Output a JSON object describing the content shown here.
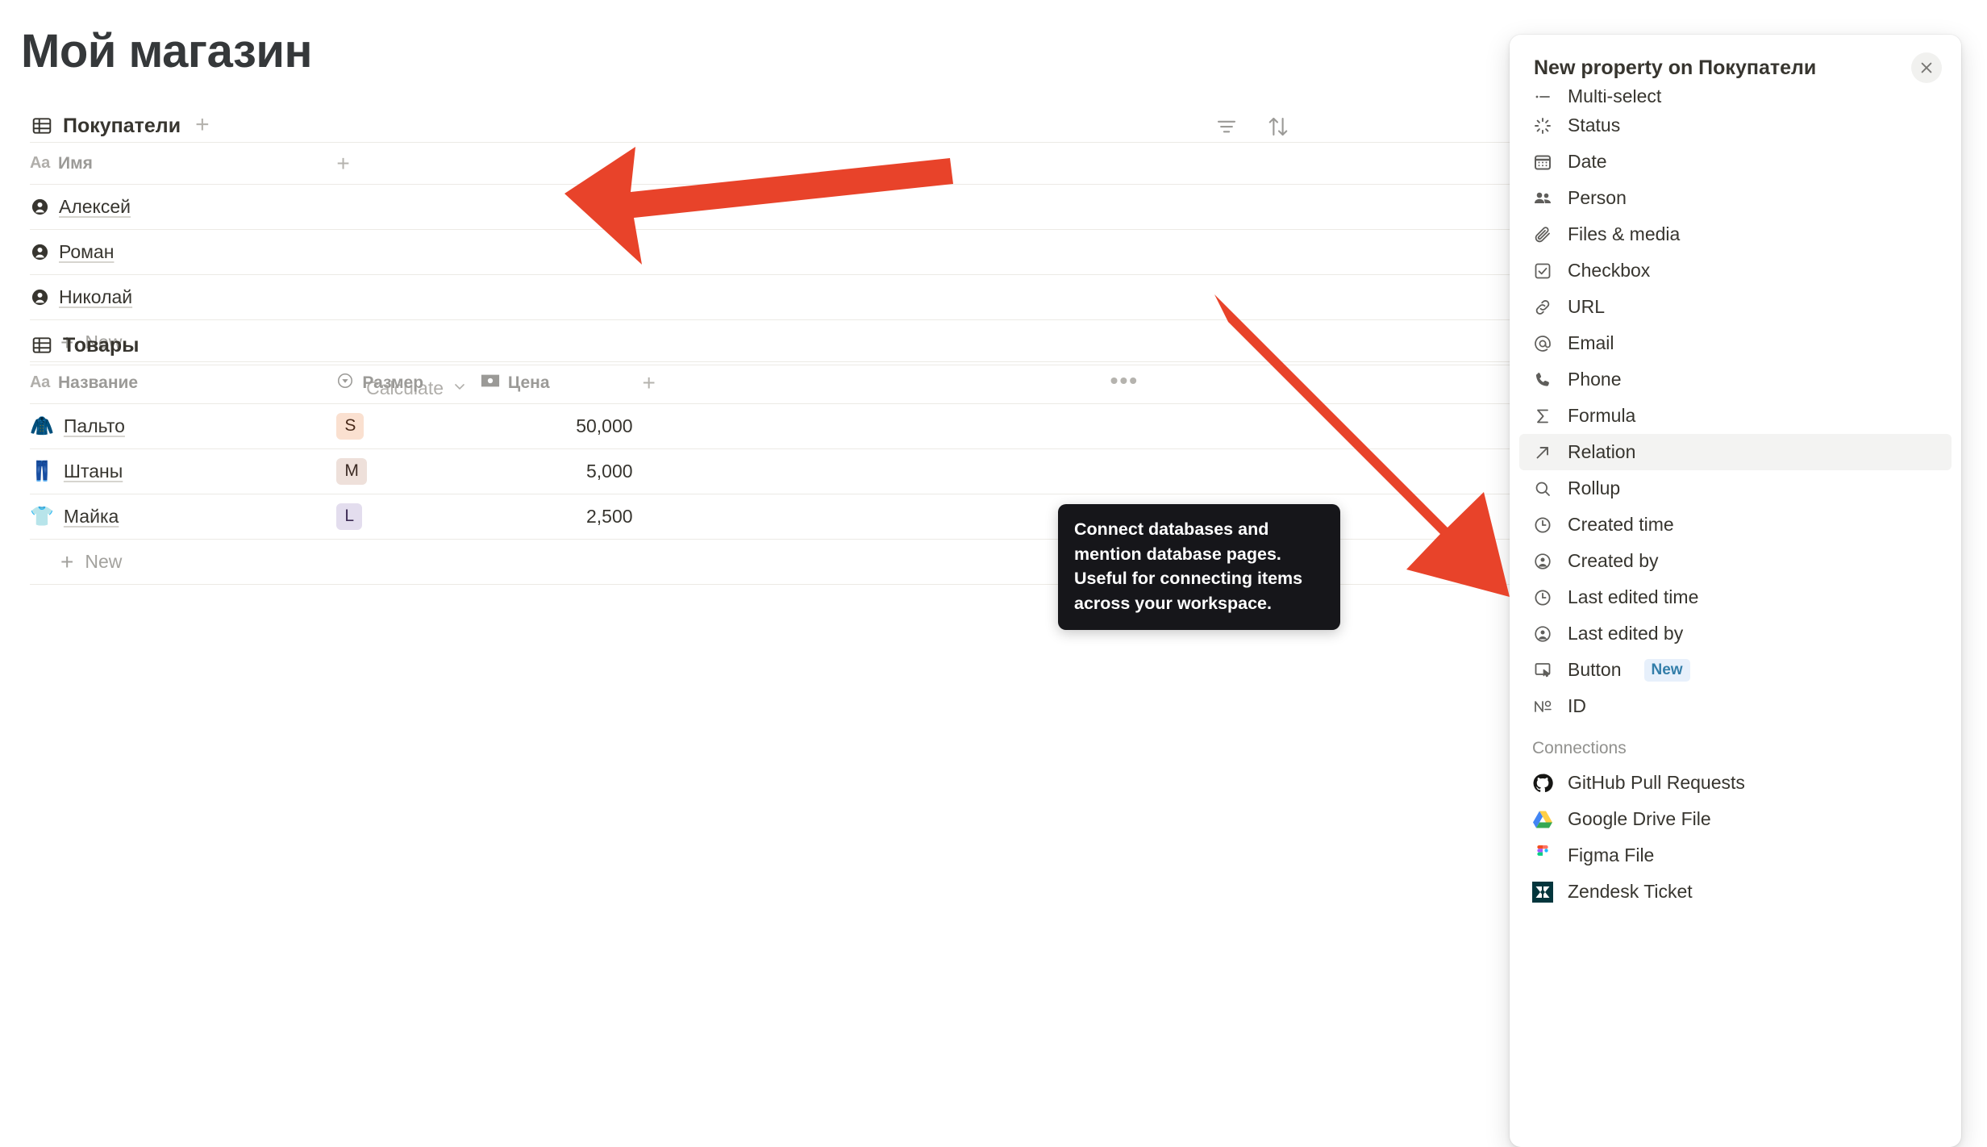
{
  "page": {
    "title": "Мой магазин"
  },
  "databases": [
    {
      "name": "Покупатели",
      "add_label": "+",
      "toolbar": {
        "filter_icon": "filter-icon",
        "sort_icon": "sort-icon"
      },
      "columns": [
        {
          "label": "Имя",
          "type_icon": "aa-text-icon",
          "prefix": "Aa"
        }
      ],
      "add_column_label": "+",
      "rows": [
        {
          "icon": "person-icon",
          "name": "Алексей"
        },
        {
          "icon": "person-icon",
          "name": "Роман"
        },
        {
          "icon": "person-icon",
          "name": "Николай"
        }
      ],
      "new_row_label": "New",
      "calculate_label": "Calculate"
    },
    {
      "name": "Товары",
      "columns": [
        {
          "label": "Название",
          "type_icon": "aa-text-icon",
          "prefix": "Aa"
        },
        {
          "label": "Размер",
          "type_icon": "select-icon"
        },
        {
          "label": "Цена",
          "type_icon": "money-icon"
        }
      ],
      "add_column_label": "+",
      "more_label": "•••",
      "rows": [
        {
          "emoji": "🧥",
          "name": "Пальто",
          "size": "S",
          "size_bg": "#fae0d0",
          "size_fg": "#4a2b1b",
          "price": "50,000"
        },
        {
          "emoji": "👖",
          "name": "Штаны",
          "size": "M",
          "size_bg": "#eee0da",
          "size_fg": "#3b2a23",
          "price": "5,000"
        },
        {
          "emoji": "👕",
          "name": "Майка",
          "size": "L",
          "size_bg": "#e3ddee",
          "size_fg": "#3c2b54",
          "price": "2,500"
        }
      ],
      "new_row_label": "New"
    }
  ],
  "tooltip": {
    "text": "Connect databases and mention database pages. Useful for connecting items across your workspace."
  },
  "panel": {
    "title": "New property on Покупатели",
    "close_icon": "close-icon",
    "items": [
      {
        "label": "Multi-select",
        "icon": "multi-select-icon",
        "clipped": true
      },
      {
        "label": "Status",
        "icon": "status-icon"
      },
      {
        "label": "Date",
        "icon": "calendar-icon"
      },
      {
        "label": "Person",
        "icon": "person-group-icon"
      },
      {
        "label": "Files & media",
        "icon": "paperclip-icon"
      },
      {
        "label": "Checkbox",
        "icon": "checkbox-icon"
      },
      {
        "label": "URL",
        "icon": "link-icon"
      },
      {
        "label": "Email",
        "icon": "at-icon"
      },
      {
        "label": "Phone",
        "icon": "phone-icon"
      },
      {
        "label": "Formula",
        "icon": "sigma-icon"
      },
      {
        "label": "Relation",
        "icon": "arrow-up-right-icon",
        "selected": true
      },
      {
        "label": "Rollup",
        "icon": "magnifier-icon"
      },
      {
        "label": "Created time",
        "icon": "clock-icon"
      },
      {
        "label": "Created by",
        "icon": "user-circle-icon"
      },
      {
        "label": "Last edited time",
        "icon": "clock-icon"
      },
      {
        "label": "Last edited by",
        "icon": "user-circle-icon"
      },
      {
        "label": "Button",
        "icon": "button-icon",
        "badge": "New"
      },
      {
        "label": "ID",
        "icon": "numero-icon"
      }
    ],
    "connections_label": "Connections",
    "connections": [
      {
        "label": "GitHub Pull Requests",
        "icon": "github-icon"
      },
      {
        "label": "Google Drive File",
        "icon": "google-drive-icon"
      },
      {
        "label": "Figma File",
        "icon": "figma-icon"
      },
      {
        "label": "Zendesk Ticket",
        "icon": "zendesk-icon"
      }
    ]
  },
  "annotations": {
    "arrow_color": "#e8432a",
    "arrow_1": "points-left-to-add-column-button",
    "arrow_2": "points-down-right-to-relation-item"
  }
}
